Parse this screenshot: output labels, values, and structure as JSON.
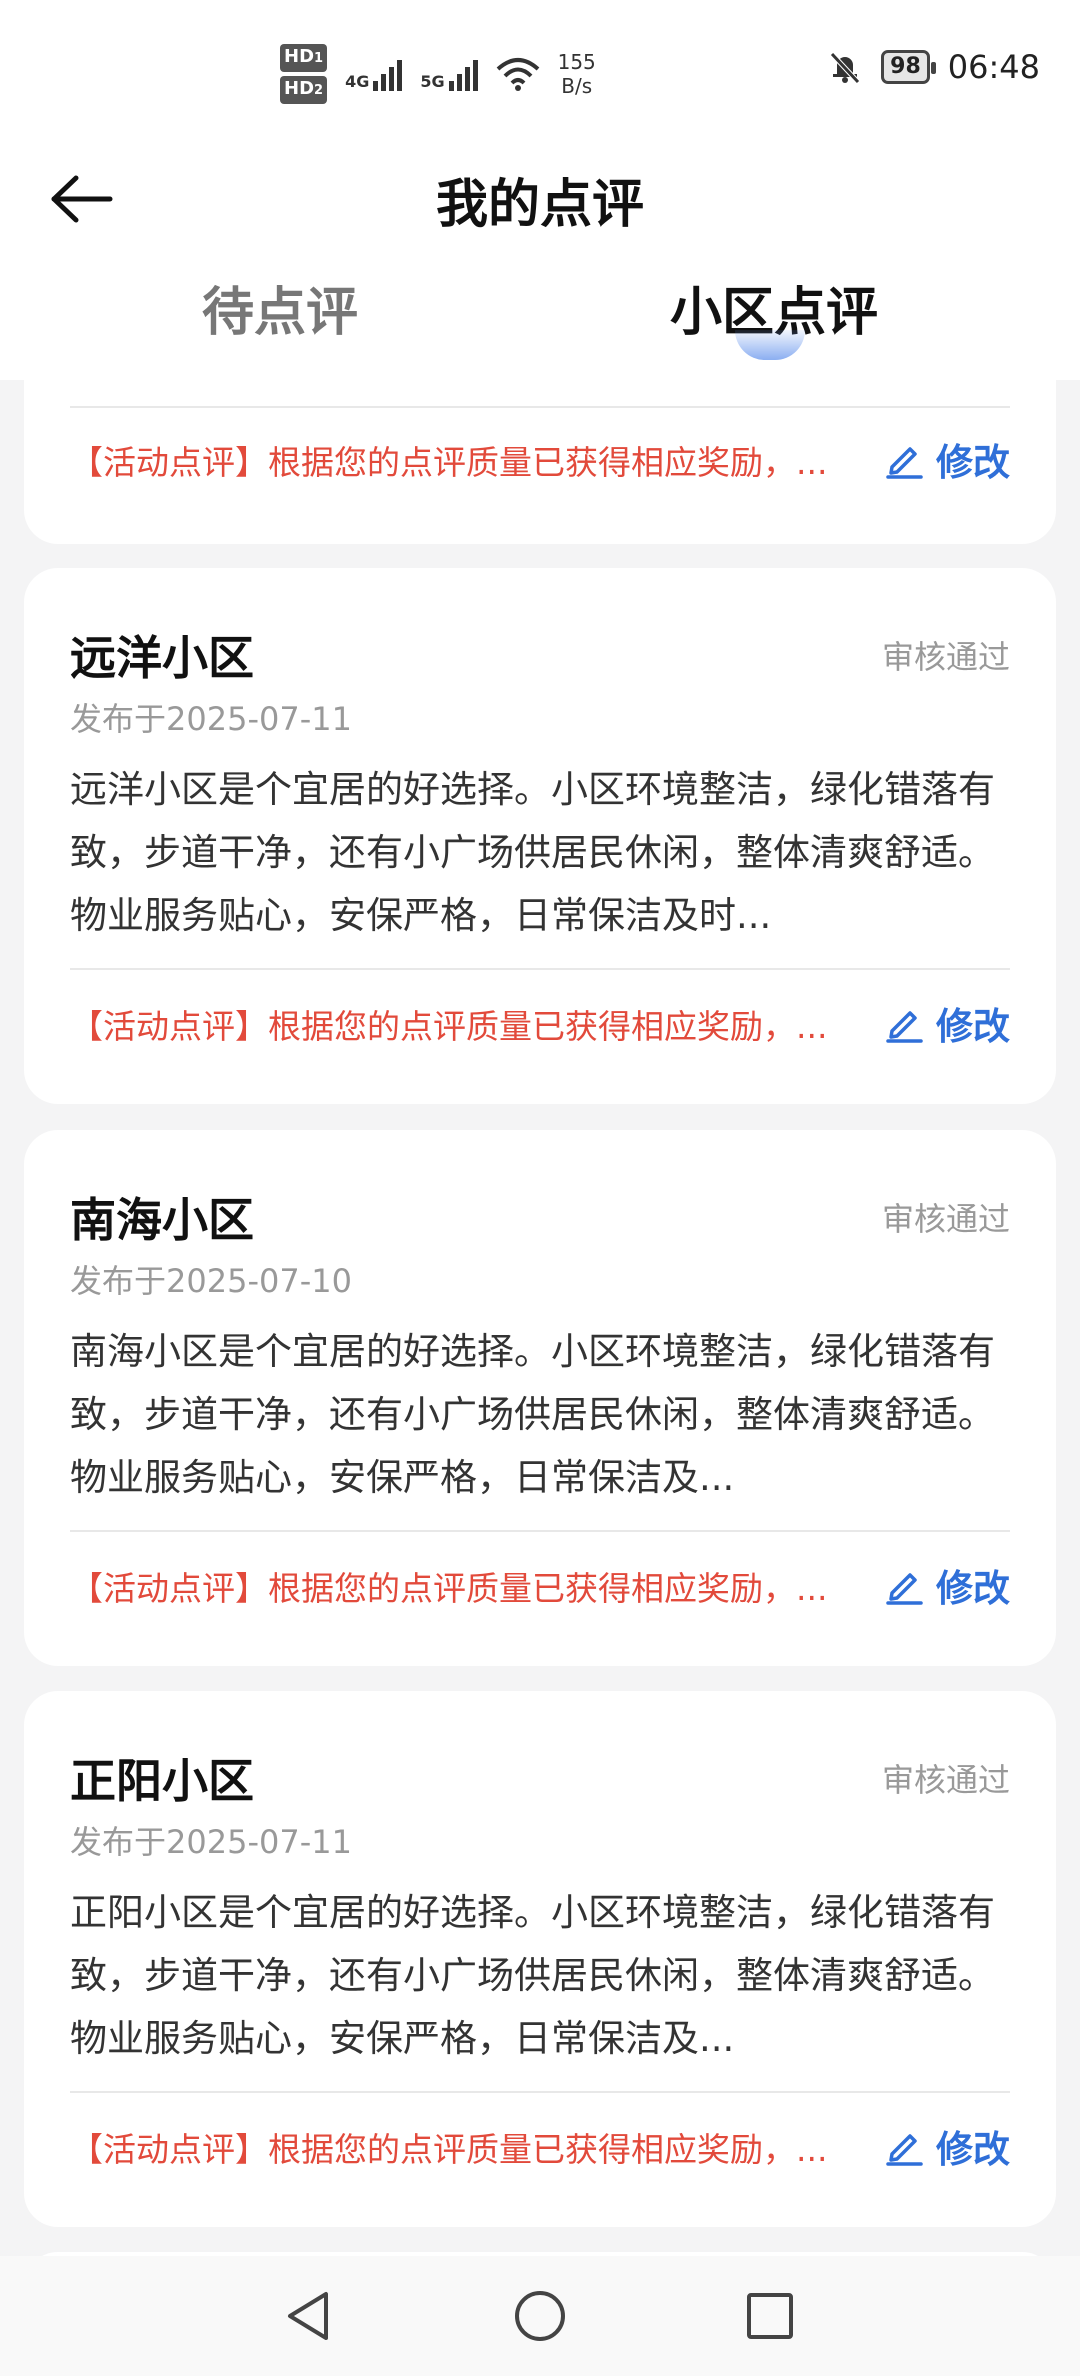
{
  "status_bar": {
    "sim1": "HD",
    "sim1_num": "1",
    "sim2": "HD",
    "sim2_num": "2",
    "net4g": "4G",
    "net5g": "5G",
    "speed_value": "155",
    "speed_unit": "B/s",
    "battery": "98",
    "time": "06:48",
    "icons": [
      "mute-bell-icon",
      "wifi-icon",
      "signal-icon"
    ]
  },
  "header": {
    "title": "我的点评",
    "tabs": [
      {
        "label": "待点评",
        "active": false
      },
      {
        "label": "小区点评",
        "active": true
      }
    ]
  },
  "reviews": [
    {
      "name": "",
      "status": "",
      "date": "",
      "text": "",
      "reward": "【活动点评】根据您的点评质量已获得相应奖励，...",
      "edit_label": "修改"
    },
    {
      "name": "远洋小区",
      "status": "审核通过",
      "date": "发布于2025-07-11",
      "text": "远洋小区是个宜居的好选择。小区环境整洁，绿化错落有致，步道干净，还有小广场供居民休闲，整体清爽舒适。 物业服务贴心，安保严格，日常保洁及时...",
      "reward": "【活动点评】根据您的点评质量已获得相应奖励，...",
      "edit_label": "修改"
    },
    {
      "name": "南海小区",
      "status": "审核通过",
      "date": "发布于2025-07-10",
      "text": "南海小区是个宜居的好选择。小区环境整洁，绿化错落有致，步道干净，还有小广场供居民休闲，整体清爽舒适。  物业服务贴心，安保严格，日常保洁及...",
      "reward": "【活动点评】根据您的点评质量已获得相应奖励，...",
      "edit_label": "修改"
    },
    {
      "name": "正阳小区",
      "status": "审核通过",
      "date": "发布于2025-07-11",
      "text": "正阳小区是个宜居的好选择。小区环境整洁，绿化错落有致，步道干净，还有小广场供居民休闲，整体清爽舒适。   物业服务贴心，安保严格，日常保洁及...",
      "reward": "【活动点评】根据您的点评质量已获得相应奖励，...",
      "edit_label": "修改"
    }
  ],
  "nav": [
    "back-triangle-icon",
    "home-circle-icon",
    "recents-square-icon"
  ]
}
